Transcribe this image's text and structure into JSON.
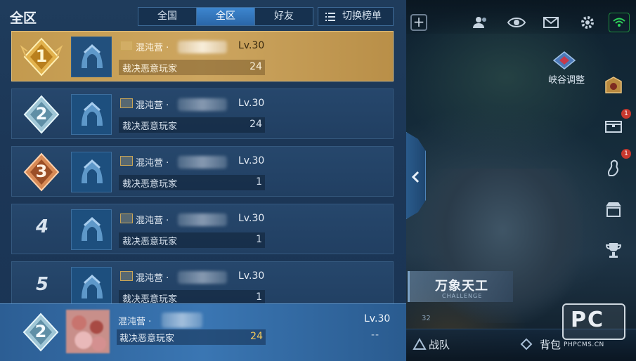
{
  "panel": {
    "title": "全区",
    "tabs": [
      {
        "label": "全国",
        "active": false
      },
      {
        "label": "全区",
        "active": true
      },
      {
        "label": "好友",
        "active": false
      }
    ],
    "switch_label": "切换榜单",
    "switch_icon": "list-icon"
  },
  "rows": [
    {
      "rank": "1",
      "guild": "混沌营",
      "sep": "·",
      "level": "Lv.30",
      "title": "裁决恶意玩家",
      "count": "24"
    },
    {
      "rank": "2",
      "guild": "混沌营",
      "sep": "·",
      "level": "Lv.30",
      "title": "裁决恶意玩家",
      "count": "24"
    },
    {
      "rank": "3",
      "guild": "混沌营",
      "sep": "·",
      "level": "Lv.30",
      "title": "裁决恶意玩家",
      "count": "1"
    },
    {
      "rank": "4",
      "guild": "混沌营",
      "sep": "·",
      "level": "Lv.30",
      "title": "裁决恶意玩家",
      "count": "1"
    },
    {
      "rank": "5",
      "guild": "混沌营",
      "sep": "·",
      "level": "Lv.30",
      "title": "裁决恶意玩家",
      "count": "1"
    }
  ],
  "self_row": {
    "rank": "2",
    "guild": "混沌营",
    "sep": "·",
    "level": "Lv.30",
    "title": "裁决恶意玩家",
    "count": "24",
    "dash": "--"
  },
  "scene": {
    "rift_label": "峡谷调整",
    "challenge_title": "万象天工",
    "challenge_sub": "CHALLENGE",
    "counter": "32",
    "bottom_items": [
      "战队",
      "背包"
    ],
    "watermark_logo": "PC",
    "watermark_url": "PHPCMS.CN",
    "badges": [
      "1",
      "1",
      "1"
    ]
  },
  "colors": {
    "panel_bg": "#1f3c5c",
    "gold_row": "#c39a4e",
    "active_tab": "#3d86cf",
    "self_count": "#f3c95a"
  }
}
